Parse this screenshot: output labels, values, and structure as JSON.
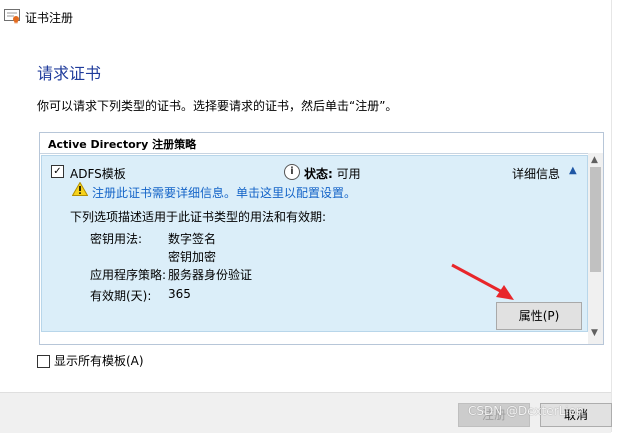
{
  "window": {
    "title": "证书注册"
  },
  "page": {
    "heading": "请求证书",
    "description": "你可以请求下列类型的证书。选择要请求的证书，然后单击“注册”。"
  },
  "policy": {
    "header": "Active Directory 注册策略",
    "item": {
      "checked": true,
      "name": "ADFS模板",
      "status_label": "状态:",
      "status_value": "可用",
      "details_link": "详细信息",
      "warning": "注册此证书需要详细信息。单击这里以配置设置。",
      "options_description": "下列选项描述适用于此证书类型的用法和有效期:",
      "key_usage_label": "密钥用法:",
      "key_usage_values": [
        "数字签名",
        "密钥加密"
      ],
      "app_policy_label": "应用程序策略:",
      "app_policy_value": "服务器身份验证",
      "validity_label": "有效期(天):",
      "validity_value": "365",
      "properties_button": "属性(P)"
    }
  },
  "show_all_templates": {
    "checked": false,
    "label": "显示所有模板(A)"
  },
  "footer": {
    "enroll_button": "注册",
    "cancel_button": "取消"
  },
  "watermark": "CSDN @DexterLien",
  "colors": {
    "heading": "#1f3b9b",
    "link": "#1464c8",
    "panel": "#dbeef9",
    "arrow": "#e8262b"
  }
}
